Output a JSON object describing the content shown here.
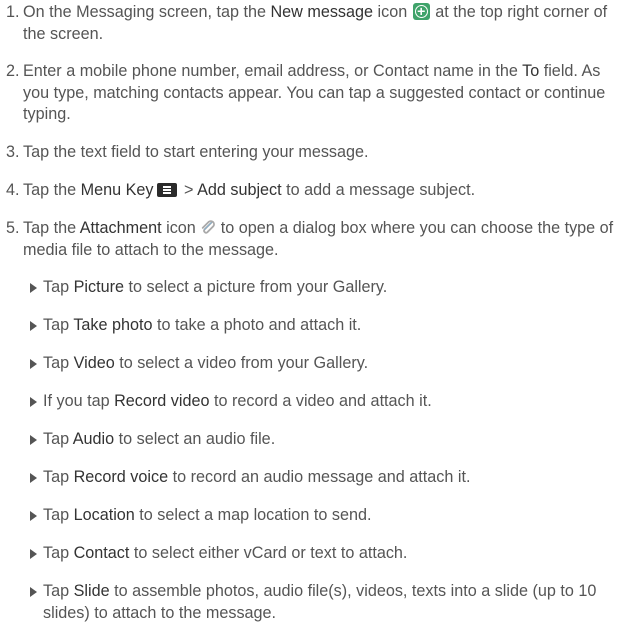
{
  "steps": [
    {
      "number": "1.",
      "parts": [
        "On the Messaging screen, tap the ",
        "New message",
        " icon ",
        " at the top right corner of the screen."
      ],
      "icon": "new-message-icon"
    },
    {
      "number": "2.",
      "parts": [
        "Enter a mobile phone number, email address, or Contact name in the ",
        "To",
        " field. As you type, matching contacts appear. You can tap a suggested contact or continue typing."
      ]
    },
    {
      "number": "3.",
      "text": "Tap the text field to start entering your message."
    },
    {
      "number": "4.",
      "parts": [
        "Tap the ",
        "Menu Key",
        " > ",
        "Add subject",
        " to add a message subject."
      ],
      "icon": "menu-key-icon"
    },
    {
      "number": "5.",
      "parts": [
        "Tap the ",
        "Attachment",
        " icon ",
        " to open a dialog box where you can choose the type of media file to attach to the message."
      ],
      "icon": "paperclip-icon"
    }
  ],
  "bullets": [
    {
      "pre": "Tap ",
      "bold": "Picture",
      "post": " to select a picture from your Gallery."
    },
    {
      "pre": "Tap ",
      "bold": "Take photo",
      "post": " to take a photo and attach it."
    },
    {
      "pre": "Tap ",
      "bold": "Video",
      "post": " to select a video from your Gallery."
    },
    {
      "pre": "If you tap ",
      "bold": "Record video",
      "post": " to record a video and attach it."
    },
    {
      "pre": "Tap ",
      "bold": "Audio",
      "post": " to select an audio file."
    },
    {
      "pre": "Tap ",
      "bold": "Record voice",
      "post": " to record an audio message and attach it."
    },
    {
      "pre": "Tap ",
      "bold": "Location",
      "post": " to select a map location to send."
    },
    {
      "pre": "Tap ",
      "bold": "Contact",
      "post": " to select either vCard or text to attach."
    },
    {
      "pre": "Tap ",
      "bold": "Slide",
      "post": " to assemble photos, audio file(s), videos, texts into a slide (up to 10 slides) to attach to the message."
    }
  ],
  "colors": {
    "body_text": "#555555",
    "emphasis_text": "#333333",
    "new_message_icon": "#3fa36a",
    "menu_key_icon": "#2b2b2b"
  }
}
